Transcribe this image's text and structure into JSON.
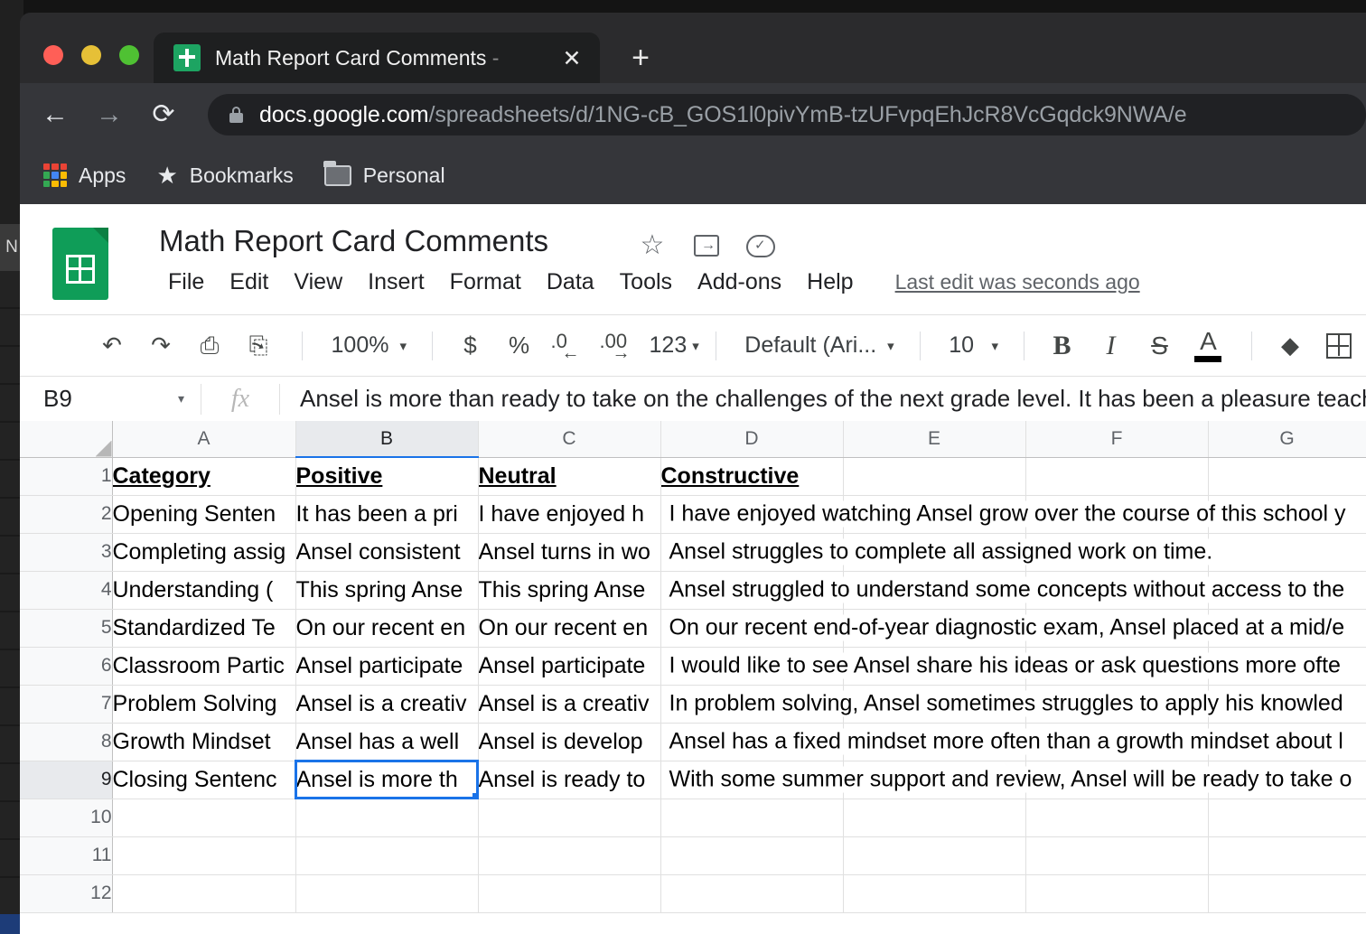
{
  "browser": {
    "tab": {
      "title": "Math Report Card Comments",
      "title_suffix": " -",
      "favicon": "sheets-favicon",
      "close_label": "✕"
    },
    "new_tab_label": "+",
    "nav": {
      "back": "←",
      "forward": "→",
      "reload": "⟳"
    },
    "omnibox": {
      "host": "docs.google.com",
      "path": "/spreadsheets/d/1NG-cB_GOS1l0pivYmB-tzUFvpqEhJcR8VcGqdck9NWA/e"
    },
    "bookmarks": [
      {
        "label": "Apps",
        "icon": "apps-grid-icon"
      },
      {
        "label": "Bookmarks",
        "icon": "star-icon"
      },
      {
        "label": "Personal",
        "icon": "folder-icon"
      }
    ]
  },
  "sheets": {
    "doc_title": "Math Report Card Comments",
    "menu": [
      "File",
      "Edit",
      "View",
      "Insert",
      "Format",
      "Data",
      "Tools",
      "Add-ons",
      "Help"
    ],
    "last_edit": "Last edit was seconds ago",
    "toolbar": {
      "undo": "↶",
      "redo": "↷",
      "print": "⎙",
      "paint_format": "⎘",
      "zoom": "100%",
      "currency": "$",
      "percent": "%",
      "decrease_decimal": ".0",
      "increase_decimal": ".00",
      "number_format": "123",
      "font": "Default (Ari...",
      "font_size": "10",
      "bold": "B",
      "italic": "I",
      "strikethrough": "S",
      "text_color": "A",
      "fill_color": "◆",
      "borders": "borders-icon",
      "caret": "▾"
    },
    "formula_bar": {
      "name_box": "B9",
      "fx": "fx",
      "value": "Ansel is more than ready to take on the challenges of the next grade level.  It has been a pleasure teachi"
    },
    "grid": {
      "columns": [
        "A",
        "B",
        "C",
        "D",
        "E",
        "F",
        "G"
      ],
      "active_column": "B",
      "active_row": 9,
      "selected_cell": "B9",
      "rows": [
        {
          "n": "1",
          "cells": [
            "Category",
            "Positive ",
            "Neutral",
            "Constructive",
            "",
            "",
            ""
          ]
        },
        {
          "n": "2",
          "cells": [
            "Opening Senten",
            "It has been a pri",
            "I have enjoyed h",
            "I have enjoyed watching Ansel grow over the course of this school y",
            "",
            "",
            ""
          ]
        },
        {
          "n": "3",
          "cells": [
            "Completing assig",
            "Ansel consistent",
            "Ansel turns in wo",
            "Ansel struggles to complete all assigned work on time.",
            "",
            "",
            ""
          ]
        },
        {
          "n": "4",
          "cells": [
            "Understanding (",
            "This spring Anse",
            "This spring Anse",
            "Ansel struggled to understand some concepts without access to the",
            "",
            "",
            ""
          ]
        },
        {
          "n": "5",
          "cells": [
            "Standardized Te",
            "On our recent en",
            "On our recent en",
            "On our recent end-of-year diagnostic exam, Ansel placed at a mid/e",
            "",
            "",
            ""
          ]
        },
        {
          "n": "6",
          "cells": [
            "Classroom Partic",
            "Ansel participate",
            "Ansel participate",
            "I would like to see Ansel share his ideas or ask questions more ofte",
            "",
            "",
            ""
          ]
        },
        {
          "n": "7",
          "cells": [
            "Problem Solving",
            "Ansel is a creativ",
            "Ansel is a creativ",
            "In problem solving, Ansel sometimes struggles to apply his knowled",
            "",
            "",
            ""
          ]
        },
        {
          "n": "8",
          "cells": [
            "Growth Mindset",
            "Ansel has a well",
            "Ansel is develop",
            "Ansel has a fixed mindset more often than a growth mindset about l",
            "",
            "",
            ""
          ]
        },
        {
          "n": "9",
          "cells": [
            "Closing Sentenc",
            "Ansel is more th",
            "Ansel is ready to",
            "With some summer support and review, Ansel will be ready to take o",
            "",
            "",
            ""
          ]
        },
        {
          "n": "10",
          "cells": [
            "",
            "",
            "",
            "",
            "",
            "",
            ""
          ]
        },
        {
          "n": "11",
          "cells": [
            "",
            "",
            "",
            "",
            "",
            "",
            ""
          ]
        },
        {
          "n": "12",
          "cells": [
            "",
            "",
            "",
            "",
            "",
            "",
            ""
          ]
        }
      ]
    }
  },
  "background_window": {
    "title_fragment": "N"
  },
  "colors": {
    "sheets_green": "#0f9d58",
    "selection_blue": "#1a73e8",
    "browser_chrome": "#35363a",
    "tab_strip": "#2b2b2d"
  }
}
